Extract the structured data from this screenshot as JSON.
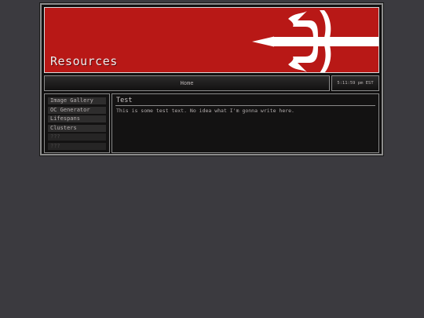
{
  "banner": {
    "title": "Resources",
    "logo_icon": "trident-icon"
  },
  "nav": {
    "home_label": "Home"
  },
  "clock": {
    "time": "5:11:59 pm EST"
  },
  "sidebar": {
    "items": [
      {
        "label": "Image Gallery",
        "dim": false
      },
      {
        "label": "OC Generator",
        "dim": false
      },
      {
        "label": "Lifespans",
        "dim": false
      },
      {
        "label": "Clusters",
        "dim": false
      },
      {
        "label": "???",
        "dim": true
      },
      {
        "label": "???",
        "dim": true
      }
    ]
  },
  "content": {
    "title": "Test",
    "body": "This is some test text. No idea what I'm gonna write here."
  },
  "colors": {
    "banner_red": "#b81816",
    "page_bg": "#3b3a3f",
    "panel_bg": "#131212"
  }
}
